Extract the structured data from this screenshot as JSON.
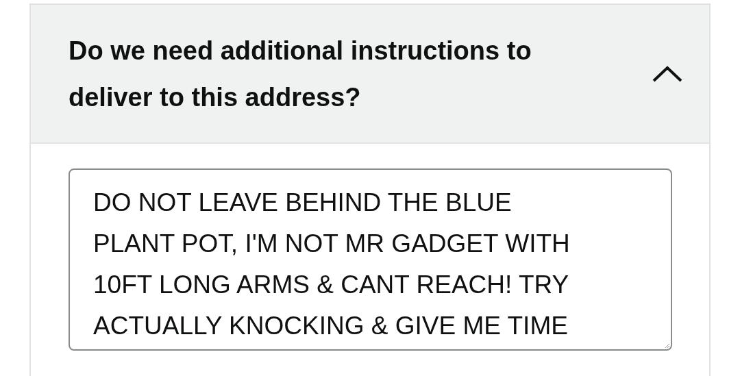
{
  "section": {
    "title": "Do we need additional instructions to deliver to this address?",
    "expanded": true
  },
  "instructions_field": {
    "value": "DO NOT LEAVE BEHIND THE BLUE\nPLANT POT, I'M NOT MR GADGET WITH\n10FT LONG ARMS & CANT REACH! TRY\nACTUALLY KNOCKING & GIVE ME TIME"
  }
}
